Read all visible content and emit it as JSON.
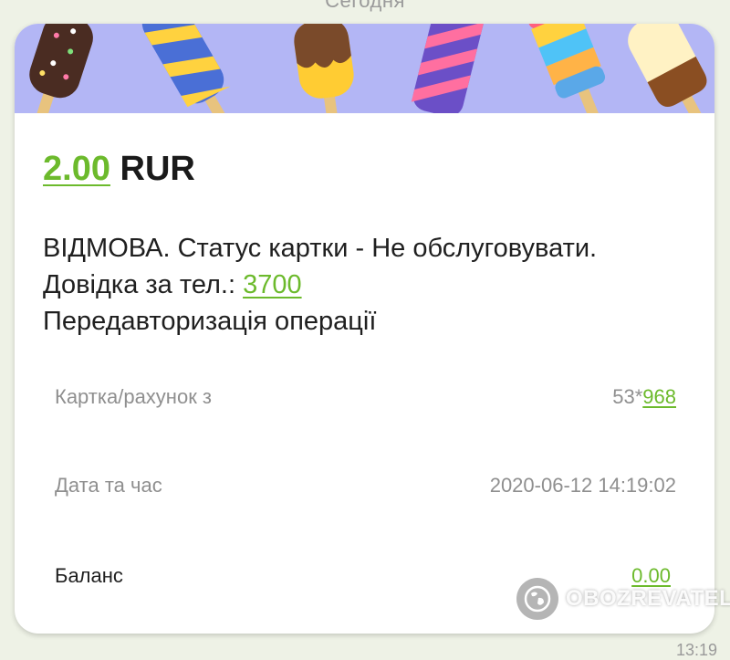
{
  "chat": {
    "date_header": "Сегодня",
    "time": "13:19"
  },
  "notification": {
    "amount_value": "2.00",
    "currency": "RUR",
    "message_part1": "ВІДМОВА. Статус картки - Не обслуговувати. Довідка за тел.: ",
    "phone": "3700",
    "message_part2": "Передавторизація операції",
    "rows": [
      {
        "label": "Картка/рахунок з",
        "value_prefix": "53*",
        "value_link": "968"
      },
      {
        "label": "Дата та час",
        "value": "2020-06-12 14:19:02"
      },
      {
        "label": "Баланс",
        "value_link": "0.00"
      }
    ]
  },
  "watermark": {
    "text": "OBOZREVATEL",
    "icon": "globe-icon"
  },
  "colors": {
    "accent_green": "#6cba2c",
    "banner_bg": "#b3b6f5"
  }
}
